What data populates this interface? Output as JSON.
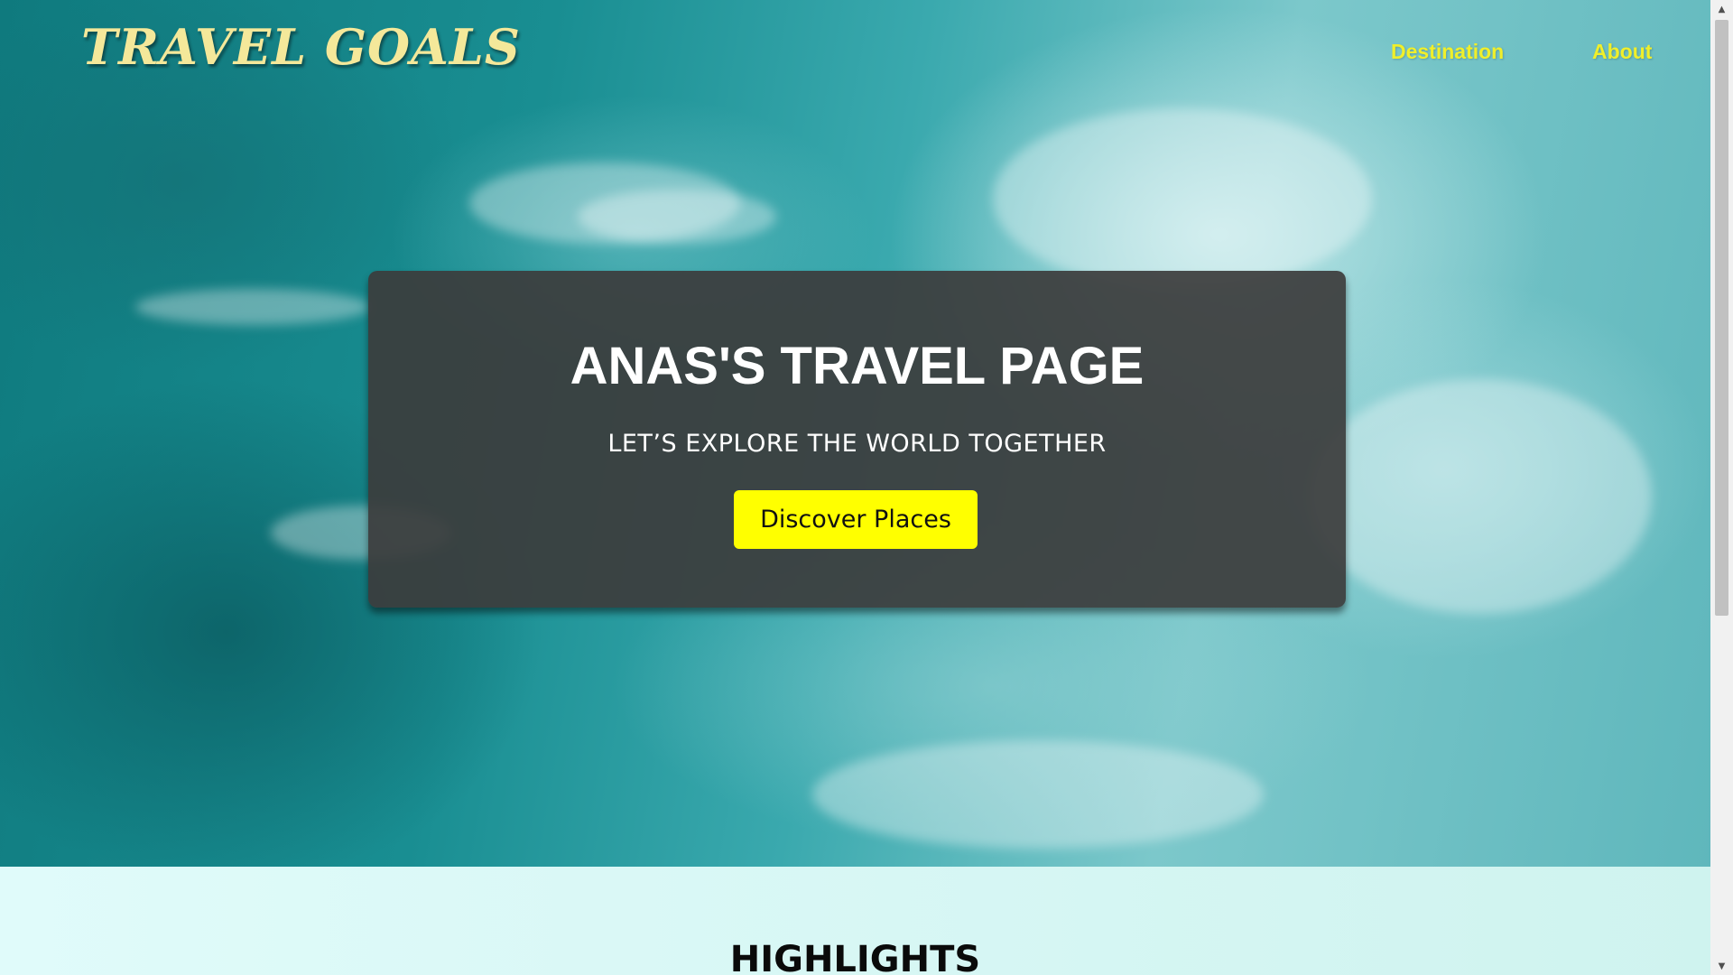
{
  "nav": {
    "logo": "TRAVEL GOALS",
    "links": [
      {
        "label": "Destination"
      },
      {
        "label": "About"
      }
    ]
  },
  "hero": {
    "title": "ANAS'S TRAVEL PAGE",
    "subtitle": "LET’S EXPLORE THE WORLD TOGETHER",
    "cta_label": "Discover Places"
  },
  "highlights": {
    "title": "HIGHLIGHTS"
  },
  "colors": {
    "accent_yellow": "#ffff00",
    "nav_link": "#f0ef2a",
    "logo": "#f4e89a",
    "card_bg": "#3c3c3c",
    "section_bg": "#e0fbfa"
  },
  "icons": {
    "scroll_up": "scroll-up-arrow-icon",
    "scroll_down": "scroll-down-arrow-icon"
  }
}
